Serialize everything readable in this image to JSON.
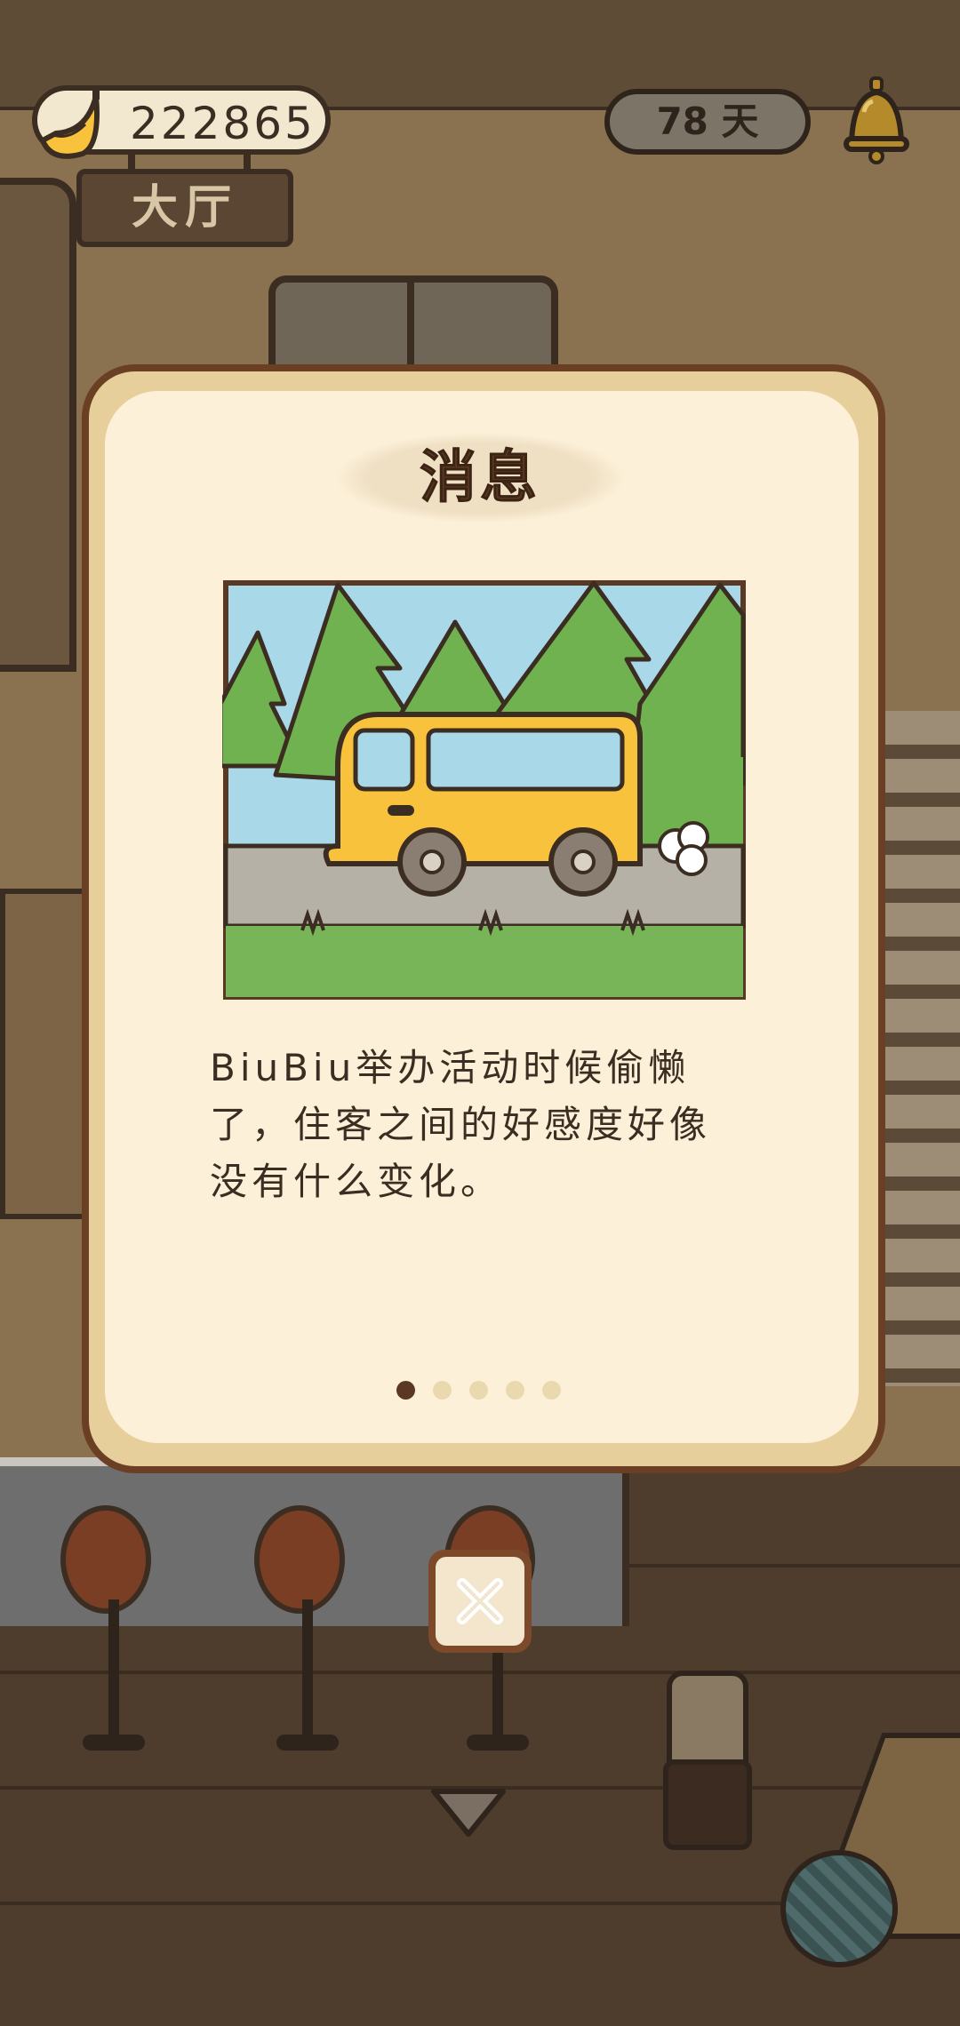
{
  "hud": {
    "coins": "222865",
    "room_name": "大厅",
    "days": "78 天"
  },
  "dialog": {
    "title": "消息",
    "message": "BiuBiu举办活动时候偷懒了，住客之间的好感度好像没有什么变化。",
    "page_count": 5,
    "current_page": 1
  },
  "icons": {
    "coin": "banana-icon",
    "notification": "bell-icon",
    "close": "close-icon",
    "expand": "chevron-down-icon",
    "yarn": "yarn-ball-icon"
  },
  "colors": {
    "dialog_border": "#6b3f24",
    "dialog_bg": "#fcf0d8",
    "title_text": "#5a3823",
    "van": "#f9c23c"
  }
}
